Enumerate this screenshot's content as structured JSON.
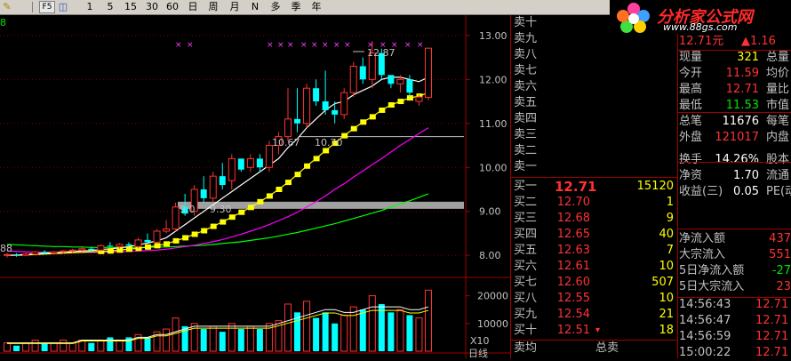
{
  "toolbar": {
    "items": [
      "F5",
      "1",
      "5",
      "15",
      "30",
      "60",
      "日",
      "周",
      "月",
      "N",
      "多",
      "季",
      "年"
    ]
  },
  "logo": {
    "title": "分析家公式网",
    "url": "www.88gs.com"
  },
  "chart": {
    "top_left_label": "8",
    "price_axis": [
      "13.00",
      "12.00",
      "11.00",
      "10.00",
      "9.00",
      "8.00"
    ],
    "vol_axis": [
      "20000",
      "10000"
    ],
    "vol_multiplier": "X10",
    "annotations": {
      "high": "12.87",
      "mid1": "10.67",
      "mid2": "10.70",
      "low1": "9.30",
      "low2": "9.0",
      "leftlow": "88"
    },
    "bottom_label": "日线",
    "colors": {
      "up": "#ff3232",
      "down": "#00ffff",
      "ma5": "#ffffff",
      "ma10": "#ffff00",
      "ma20": "#ff00ff",
      "ma60": "#00ff00"
    }
  },
  "chart_data": {
    "type": "candlestick",
    "ohlc": [
      [
        8.0,
        8.05,
        7.95,
        8.02
      ],
      [
        8.02,
        8.05,
        7.97,
        8.0
      ],
      [
        8.0,
        8.06,
        7.98,
        8.03
      ],
      [
        8.03,
        8.1,
        8.0,
        8.08
      ],
      [
        8.08,
        8.12,
        8.03,
        8.05
      ],
      [
        8.05,
        8.1,
        8.02,
        8.08
      ],
      [
        8.08,
        8.12,
        8.04,
        8.1
      ],
      [
        8.1,
        8.15,
        8.06,
        8.12
      ],
      [
        8.12,
        8.18,
        8.08,
        8.15
      ],
      [
        8.15,
        8.2,
        8.1,
        8.12
      ],
      [
        8.12,
        8.25,
        8.1,
        8.22
      ],
      [
        8.22,
        8.3,
        8.18,
        8.2
      ],
      [
        8.2,
        8.28,
        8.15,
        8.25
      ],
      [
        8.25,
        8.3,
        8.2,
        8.22
      ],
      [
        8.2,
        8.4,
        8.16,
        8.35
      ],
      [
        8.35,
        8.5,
        8.3,
        8.3
      ],
      [
        8.3,
        8.6,
        8.28,
        8.55
      ],
      [
        8.55,
        8.8,
        8.5,
        8.6
      ],
      [
        8.6,
        9.2,
        8.55,
        9.1
      ],
      [
        9.1,
        9.4,
        8.9,
        8.95
      ],
      [
        9.0,
        9.6,
        8.9,
        9.5
      ],
      [
        9.5,
        9.8,
        9.2,
        9.3
      ],
      [
        9.3,
        9.9,
        9.2,
        9.8
      ],
      [
        9.8,
        10.1,
        9.5,
        9.6
      ],
      [
        9.7,
        10.3,
        9.5,
        10.2
      ],
      [
        10.2,
        10.1,
        9.9,
        9.95
      ],
      [
        10.0,
        10.3,
        9.9,
        10.2
      ],
      [
        10.2,
        10.3,
        9.9,
        10.0
      ],
      [
        10.0,
        10.6,
        9.9,
        10.5
      ],
      [
        10.5,
        10.8,
        10.3,
        10.7
      ],
      [
        10.7,
        11.8,
        10.6,
        11.1
      ],
      [
        11.1,
        11.8,
        10.8,
        11.0
      ],
      [
        11.0,
        11.9,
        10.9,
        11.8
      ],
      [
        11.8,
        12.0,
        11.4,
        11.5
      ],
      [
        11.5,
        12.2,
        11.2,
        11.3
      ],
      [
        11.3,
        11.5,
        11.0,
        11.2
      ],
      [
        11.2,
        11.8,
        11.1,
        11.7
      ],
      [
        11.7,
        12.4,
        11.6,
        12.3
      ],
      [
        12.3,
        12.5,
        11.9,
        12.0
      ],
      [
        12.0,
        12.87,
        11.8,
        12.6
      ],
      [
        12.6,
        12.7,
        12.0,
        12.1
      ],
      [
        12.1,
        12.1,
        11.8,
        11.9
      ],
      [
        11.9,
        12.1,
        11.7,
        12.0
      ],
      [
        12.0,
        12.1,
        11.6,
        11.7
      ],
      [
        11.5,
        11.65,
        11.4,
        11.6
      ],
      [
        11.59,
        12.71,
        11.53,
        12.71
      ]
    ],
    "volume": [
      3,
      2,
      3,
      4,
      3,
      3,
      4,
      3,
      4,
      3,
      4,
      5,
      4,
      5,
      6,
      5,
      7,
      8,
      12,
      9,
      10,
      8,
      9,
      7,
      10,
      8,
      9,
      8,
      10,
      11,
      17,
      14,
      18,
      12,
      14,
      10,
      13,
      16,
      15,
      20,
      17,
      14,
      15,
      13,
      12,
      22
    ],
    "ylim": [
      7.6,
      13.3
    ],
    "ma5": [
      8.0,
      8.01,
      8.02,
      8.04,
      8.05,
      8.06,
      8.07,
      8.09,
      8.1,
      8.11,
      8.13,
      8.15,
      8.17,
      8.2,
      8.24,
      8.28,
      8.33,
      8.4,
      8.55,
      8.7,
      8.85,
      9.0,
      9.15,
      9.3,
      9.45,
      9.6,
      9.75,
      9.9,
      10.05,
      10.2,
      10.45,
      10.65,
      10.9,
      11.1,
      11.3,
      11.45,
      11.5,
      11.65,
      11.75,
      11.85,
      12.0,
      12.05,
      12.05,
      12.0,
      11.95,
      12.05
    ],
    "ma10": [
      8.0,
      8.0,
      8.01,
      8.02,
      8.03,
      8.04,
      8.05,
      8.06,
      8.07,
      8.08,
      8.09,
      8.1,
      8.12,
      8.14,
      8.16,
      8.19,
      8.22,
      8.26,
      8.33,
      8.4,
      8.48,
      8.56,
      8.66,
      8.76,
      8.87,
      8.98,
      9.09,
      9.22,
      9.35,
      9.5,
      9.66,
      9.84,
      10.03,
      10.2,
      10.38,
      10.55,
      10.72,
      10.88,
      11.03,
      11.15,
      11.3,
      11.42,
      11.5,
      11.58,
      11.62,
      11.7
    ],
    "ma20": [
      8.1,
      8.09,
      8.08,
      8.07,
      8.07,
      8.07,
      8.07,
      8.07,
      8.07,
      8.07,
      8.07,
      8.08,
      8.08,
      8.09,
      8.1,
      8.11,
      8.12,
      8.14,
      8.17,
      8.2,
      8.23,
      8.27,
      8.31,
      8.36,
      8.42,
      8.48,
      8.55,
      8.62,
      8.7,
      8.79,
      8.88,
      8.98,
      9.1,
      9.22,
      9.35,
      9.5,
      9.63,
      9.78,
      9.92,
      10.06,
      10.2,
      10.35,
      10.5,
      10.63,
      10.77,
      10.9
    ],
    "ma60": [
      8.25,
      8.24,
      8.23,
      8.22,
      8.21,
      8.2,
      8.2,
      8.19,
      8.19,
      8.18,
      8.18,
      8.18,
      8.18,
      8.18,
      8.18,
      8.18,
      8.19,
      8.19,
      8.2,
      8.21,
      8.22,
      8.23,
      8.25,
      8.27,
      8.29,
      8.31,
      8.34,
      8.37,
      8.4,
      8.44,
      8.48,
      8.52,
      8.57,
      8.62,
      8.67,
      8.72,
      8.78,
      8.84,
      8.9,
      8.96,
      9.02,
      9.1,
      9.17,
      9.24,
      9.32,
      9.4
    ],
    "volma": [
      3,
      3,
      3,
      3,
      3,
      3,
      3,
      3,
      4,
      4,
      4,
      4,
      4,
      4,
      5,
      5,
      6,
      6,
      7,
      8,
      9,
      9,
      9,
      9,
      9,
      9,
      9,
      9,
      9,
      10,
      11,
      12,
      13,
      14,
      15,
      15,
      14,
      14,
      15,
      16,
      16,
      16,
      16,
      15,
      15,
      16
    ]
  },
  "order_book": {
    "sells": [
      {
        "label": "卖十"
      },
      {
        "label": "卖九"
      },
      {
        "label": "卖八"
      },
      {
        "label": "卖七"
      },
      {
        "label": "卖六"
      },
      {
        "label": "卖五"
      },
      {
        "label": "卖四"
      },
      {
        "label": "卖三"
      },
      {
        "label": "卖二"
      },
      {
        "label": "卖一"
      }
    ],
    "buys": [
      {
        "label": "买一",
        "price": "12.71",
        "vol": "15120"
      },
      {
        "label": "买二",
        "price": "12.70",
        "vol": "1"
      },
      {
        "label": "买三",
        "price": "12.68",
        "vol": "9"
      },
      {
        "label": "买四",
        "price": "12.65",
        "vol": "40"
      },
      {
        "label": "买五",
        "price": "12.63",
        "vol": "7"
      },
      {
        "label": "买六",
        "price": "12.61",
        "vol": "10"
      },
      {
        "label": "买七",
        "price": "12.60",
        "vol": "507"
      },
      {
        "label": "买八",
        "price": "12.55",
        "vol": "10"
      },
      {
        "label": "买九",
        "price": "12.54",
        "vol": "21"
      },
      {
        "label": "买十",
        "price": "12.51",
        "vol": "18"
      }
    ],
    "footer_left": "卖均",
    "footer_right": "总卖",
    "arrow": "▾"
  },
  "info": {
    "price_line": "12.71元",
    "change": "▲1.16",
    "rows": [
      {
        "k": "现量",
        "v": "321",
        "k2": "总量"
      },
      {
        "k": "今开",
        "v": "11.59",
        "k2": "均价"
      },
      {
        "k": "最高",
        "v": "12.71",
        "k2": "量比"
      },
      {
        "k": "最低",
        "v": "11.53",
        "k2": "市值"
      },
      {
        "k": "总笔",
        "v": "11676",
        "k2": "每笔"
      },
      {
        "k": "外盘",
        "v": "121017",
        "k2": "内盘"
      },
      {
        "k": "换手",
        "v": "14.26%",
        "k2": "股本"
      },
      {
        "k": "净资",
        "v": "1.70",
        "k2": "流通"
      },
      {
        "k": "收益(三)",
        "v": "0.05",
        "k2": "PE(动"
      }
    ],
    "flows": [
      {
        "k": "净流入额",
        "v": "437"
      },
      {
        "k": "大宗流入",
        "v": "551"
      },
      {
        "k": "5日净流入额",
        "v": "-27"
      },
      {
        "k": "5日大宗流入",
        "v": "23"
      }
    ],
    "ticks": [
      {
        "t": "14:56:43",
        "p": "12.71"
      },
      {
        "t": "14:56:47",
        "p": "12.71"
      },
      {
        "t": "14:56:59",
        "p": "12.71"
      },
      {
        "t": "15:00:22",
        "p": "12.71"
      }
    ]
  }
}
